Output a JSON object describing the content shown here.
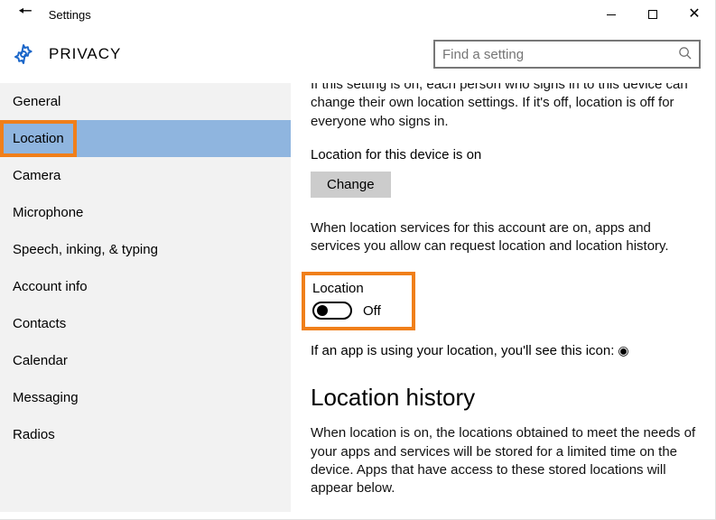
{
  "window": {
    "title": "Settings"
  },
  "header": {
    "page_title": "PRIVACY"
  },
  "search": {
    "placeholder": "Find a setting"
  },
  "sidebar": {
    "items": [
      {
        "label": "General"
      },
      {
        "label": "Location"
      },
      {
        "label": "Camera"
      },
      {
        "label": "Microphone"
      },
      {
        "label": "Speech, inking, & typing"
      },
      {
        "label": "Account info"
      },
      {
        "label": "Contacts"
      },
      {
        "label": "Calendar"
      },
      {
        "label": "Messaging"
      },
      {
        "label": "Radios"
      }
    ]
  },
  "main": {
    "intro_partial": "If this setting is on, each person who signs in to this device can change their own location settings. If it's off, location is off for everyone who signs in.",
    "device_status": "Location for this device is on",
    "change_label": "Change",
    "account_text": "When location services for this account are on, apps and services you allow can request location and location history.",
    "toggle_label": "Location",
    "toggle_state": "Off",
    "icon_line": "If an app is using your location, you'll see this icon:",
    "history_heading": "Location history",
    "history_body": "When location is on, the locations obtained to meet the needs of your apps and services will be stored for a limited time on the device. Apps that have access to these stored locations will appear below."
  }
}
